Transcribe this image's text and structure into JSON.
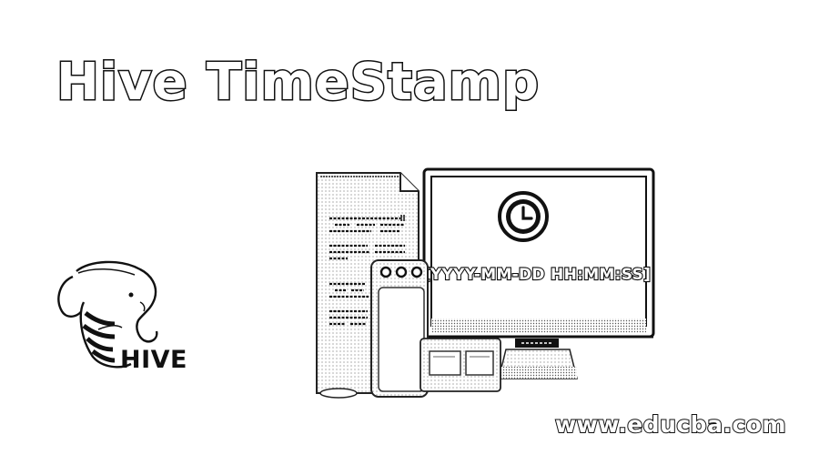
{
  "title": "Hive TimeStamp",
  "monitor": {
    "timestamp_format": "[YYYY-MM-DD HH:MM:SS]",
    "clock_icon": "clock-icon"
  },
  "brand": {
    "logo_icon": "hive-elephant-bee-icon",
    "label": "HIVE"
  },
  "website": "www.educba.com"
}
